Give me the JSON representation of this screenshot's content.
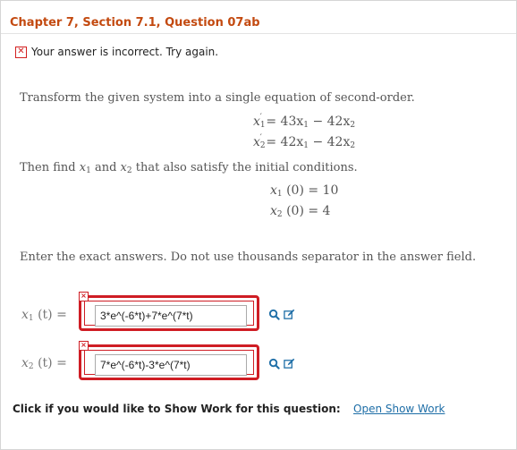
{
  "header": {
    "title": "Chapter 7, Section 7.1, Question 07ab"
  },
  "feedback": {
    "message": "Your answer is incorrect.  Try again."
  },
  "question": {
    "intro": "Transform the given system into a single equation of second-order.",
    "eq1": {
      "lhs": "x",
      "sub": "1",
      "rhs": "= 43x",
      "rhs_sub1": "1",
      "mid": " − 42x",
      "rhs_sub2": "2"
    },
    "eq2": {
      "lhs": "x",
      "sub": "2",
      "rhs": "= 42x",
      "rhs_sub1": "1",
      "mid": " − 42x",
      "rhs_sub2": "2"
    },
    "then_find": {
      "pre": "Then find ",
      "var1": "x",
      "sub1": "1",
      "and": " and ",
      "var2": "x",
      "sub2": "2",
      "post": " that also satisfy the initial conditions."
    },
    "ic1": {
      "var": "x",
      "sub": "1",
      "rest": " (0) = 10"
    },
    "ic2": {
      "var": "x",
      "sub": "2",
      "rest": " (0) = 4"
    },
    "instructions": "Enter the exact answers. Do not use thousands separator in the answer field."
  },
  "answers": [
    {
      "var": "x",
      "sub": "1",
      "rest": " (t) =",
      "value": "3*e^(-6*t)+7*e^(7*t)"
    },
    {
      "var": "x",
      "sub": "2",
      "rest": " (t) =",
      "value": "7*e^(-6*t)-3*e^(7*t)"
    }
  ],
  "show_work": {
    "prompt": "Click if you would like to Show Work for this question:",
    "link": "Open Show Work"
  },
  "colors": {
    "error": "#cf1d24",
    "title": "#c34a10",
    "link": "#1e6ea7"
  }
}
